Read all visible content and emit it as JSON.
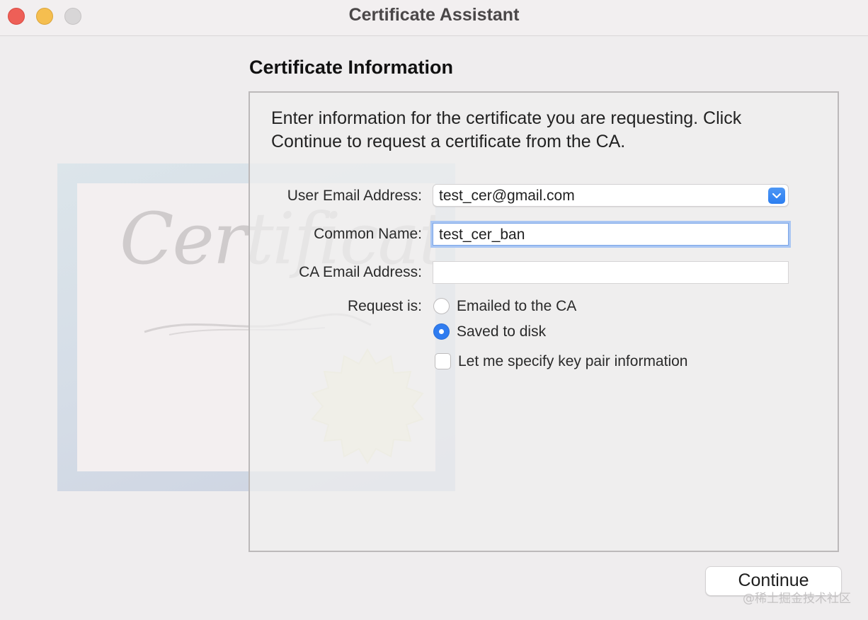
{
  "window": {
    "title": "Certificate Assistant"
  },
  "section": {
    "title": "Certificate Information"
  },
  "artwork": {
    "script_text": "Certificate"
  },
  "intro": {
    "text": "Enter information for the certificate you are requesting. Click Continue to request a certificate from the CA."
  },
  "form": {
    "user_email": {
      "label": "User Email Address:",
      "value": "test_cer@gmail.com"
    },
    "common_name": {
      "label": "Common Name:",
      "value": "test_cer_ban"
    },
    "ca_email": {
      "label": "CA Email Address:",
      "value": ""
    },
    "request": {
      "label": "Request is:",
      "options": [
        {
          "label": "Emailed to the CA",
          "selected": false
        },
        {
          "label": "Saved to disk",
          "selected": true
        }
      ]
    },
    "key_pair": {
      "label": "Let me specify key pair information",
      "checked": false
    }
  },
  "buttons": {
    "continue_label": "Continue"
  },
  "watermark": {
    "text": "@稀土掘金技术社区"
  },
  "colors": {
    "accent": "#2f7cf0",
    "close": "#ee5f57",
    "minimize": "#f5be4f"
  }
}
